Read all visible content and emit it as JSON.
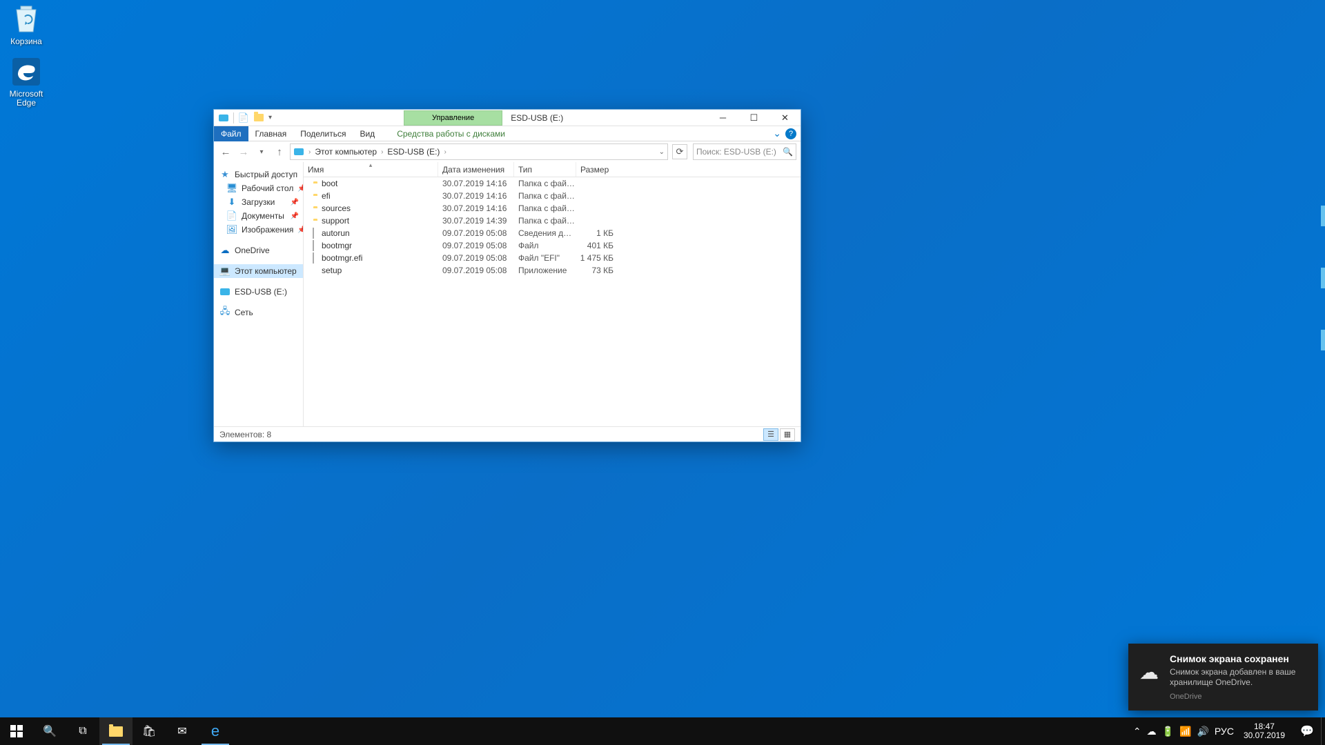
{
  "desktop": {
    "recycle_bin": "Корзина",
    "edge": "Microsoft Edge"
  },
  "window": {
    "manage_tab": "Управление",
    "title": "ESD-USB (E:)",
    "tabs": {
      "file": "Файл",
      "home": "Главная",
      "share": "Поделиться",
      "view": "Вид",
      "drive_tools": "Средства работы с дисками"
    },
    "breadcrumb": {
      "this_pc": "Этот компьютер",
      "drive": "ESD-USB (E:)"
    },
    "search_placeholder": "Поиск: ESD-USB (E:)",
    "nav": {
      "quick_access": "Быстрый доступ",
      "desktop": "Рабочий стол",
      "downloads": "Загрузки",
      "documents": "Документы",
      "pictures": "Изображения",
      "onedrive": "OneDrive",
      "this_pc": "Этот компьютер",
      "drive": "ESD-USB (E:)",
      "network": "Сеть"
    },
    "columns": {
      "name": "Имя",
      "date": "Дата изменения",
      "type": "Тип",
      "size": "Размер"
    },
    "files": [
      {
        "icon": "folder",
        "name": "boot",
        "date": "30.07.2019 14:16",
        "type": "Папка с файлами",
        "size": ""
      },
      {
        "icon": "folder",
        "name": "efi",
        "date": "30.07.2019 14:16",
        "type": "Папка с файлами",
        "size": ""
      },
      {
        "icon": "folder",
        "name": "sources",
        "date": "30.07.2019 14:16",
        "type": "Папка с файлами",
        "size": ""
      },
      {
        "icon": "folder",
        "name": "support",
        "date": "30.07.2019 14:39",
        "type": "Папка с файлами",
        "size": ""
      },
      {
        "icon": "file",
        "name": "autorun",
        "date": "09.07.2019 05:08",
        "type": "Сведения для уст...",
        "size": "1 КБ"
      },
      {
        "icon": "file",
        "name": "bootmgr",
        "date": "09.07.2019 05:08",
        "type": "Файл",
        "size": "401 КБ"
      },
      {
        "icon": "file",
        "name": "bootmgr.efi",
        "date": "09.07.2019 05:08",
        "type": "Файл \"EFI\"",
        "size": "1 475 КБ"
      },
      {
        "icon": "app",
        "name": "setup",
        "date": "09.07.2019 05:08",
        "type": "Приложение",
        "size": "73 КБ"
      }
    ],
    "status": "Элементов: 8"
  },
  "notification": {
    "title": "Снимок экрана сохранен",
    "body": "Снимок экрана добавлен в ваше хранилище OneDrive.",
    "app": "OneDrive"
  },
  "taskbar": {
    "lang": "РУС",
    "time": "18:47",
    "date": "30.07.2019"
  }
}
